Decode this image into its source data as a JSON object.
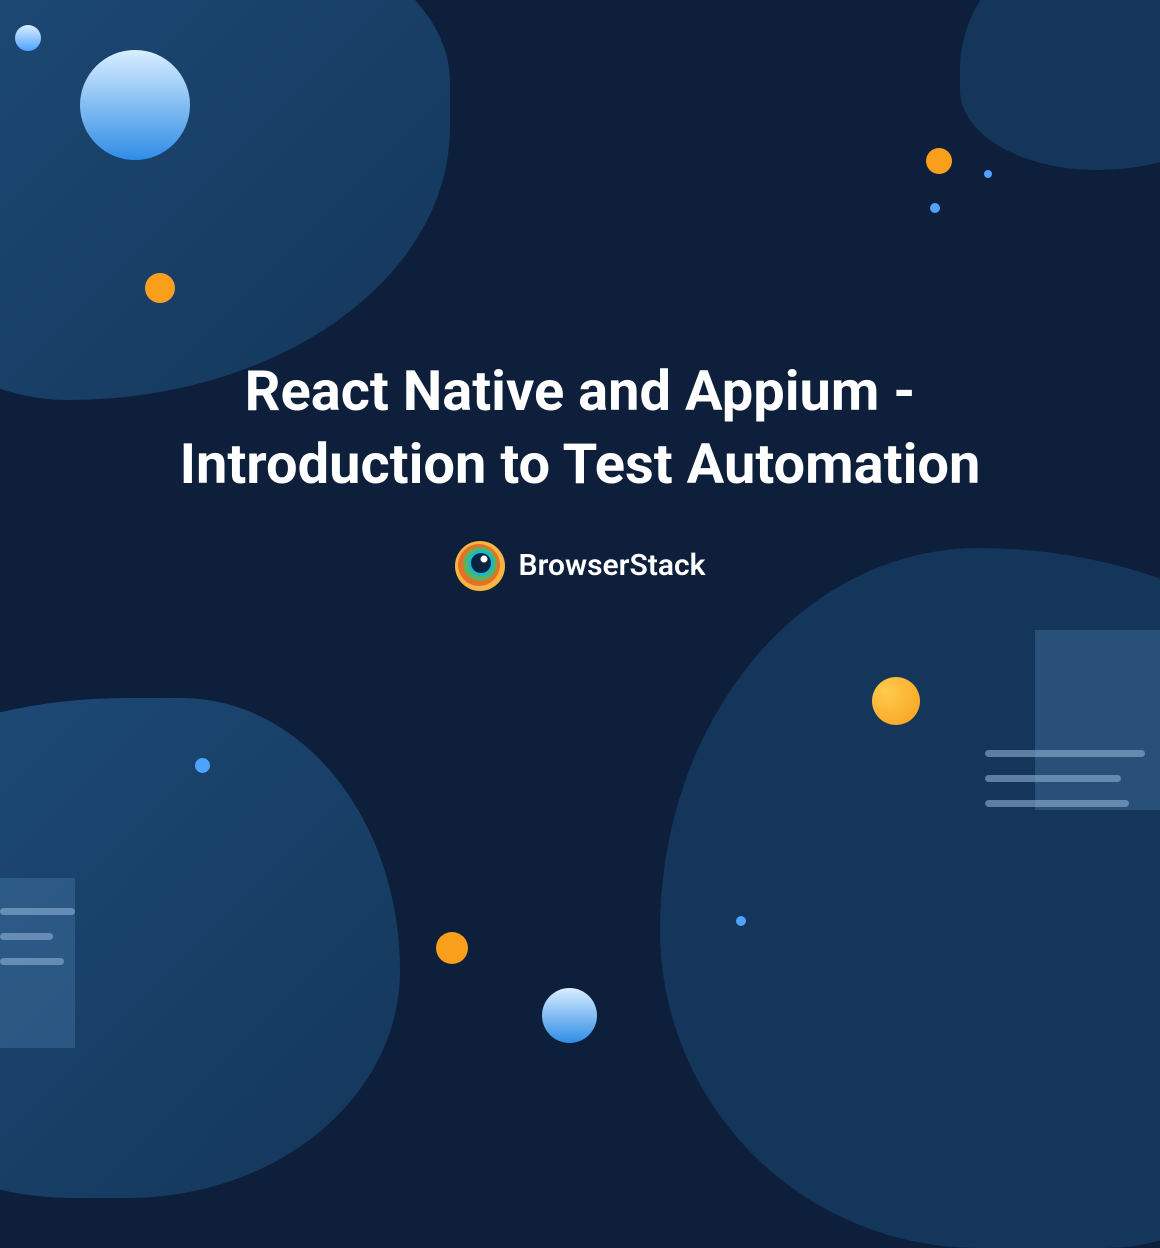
{
  "title": "React Native and Appium - Introduction to Test Automation",
  "brand": "BrowserStack"
}
